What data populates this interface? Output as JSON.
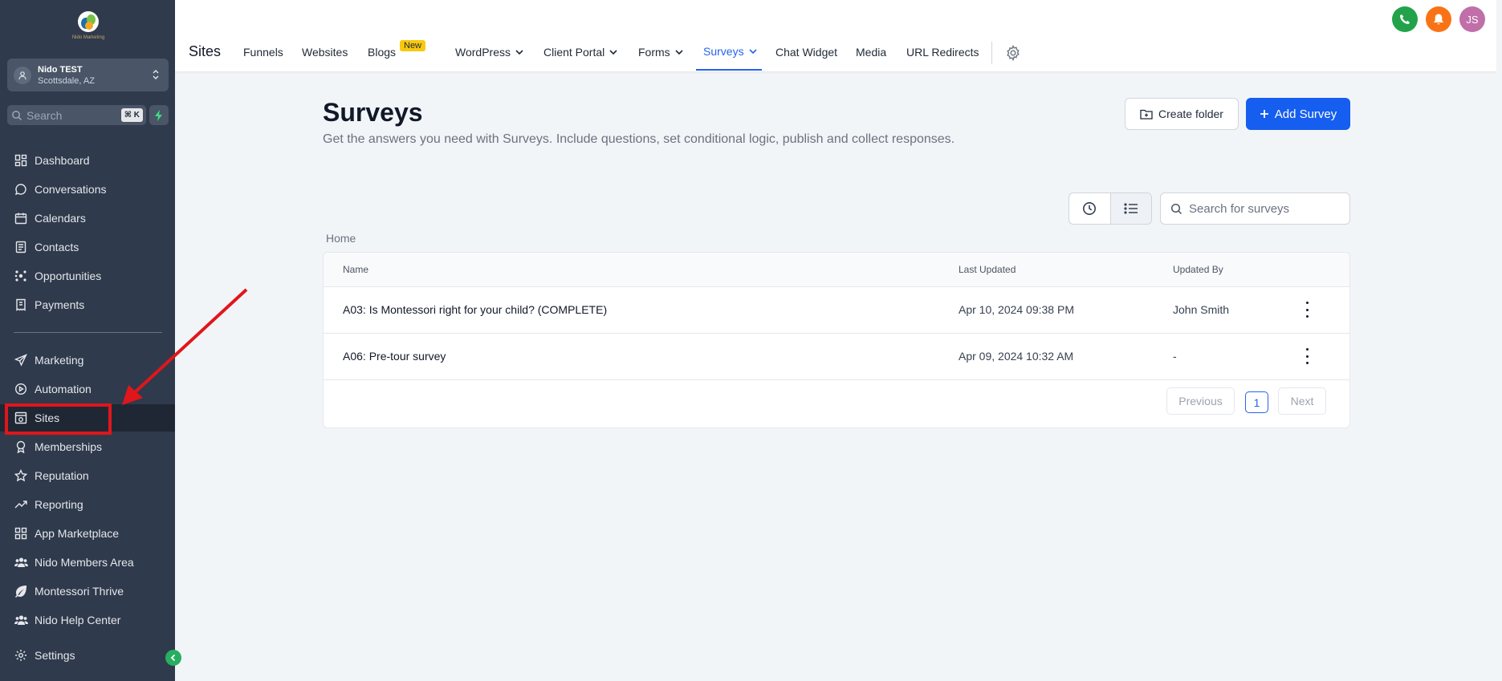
{
  "brand": {
    "logo_text": "Nido Marketing"
  },
  "account": {
    "name": "Nido TEST",
    "location": "Scottsdale, AZ"
  },
  "sidebar": {
    "search_placeholder": "Search",
    "search_shortcut": "⌘ K",
    "items": [
      {
        "label": "Dashboard",
        "icon": "dashboard-icon"
      },
      {
        "label": "Conversations",
        "icon": "chat-icon"
      },
      {
        "label": "Calendars",
        "icon": "calendar-icon"
      },
      {
        "label": "Contacts",
        "icon": "contacts-icon"
      },
      {
        "label": "Opportunities",
        "icon": "opportunities-icon"
      },
      {
        "label": "Payments",
        "icon": "payments-icon"
      },
      {
        "label": "Marketing",
        "icon": "send-icon"
      },
      {
        "label": "Automation",
        "icon": "automation-icon"
      },
      {
        "label": "Sites",
        "icon": "sites-icon",
        "active": true
      },
      {
        "label": "Memberships",
        "icon": "award-icon"
      },
      {
        "label": "Reputation",
        "icon": "star-icon"
      },
      {
        "label": "Reporting",
        "icon": "trend-icon"
      },
      {
        "label": "App Marketplace",
        "icon": "grid-icon"
      },
      {
        "label": "Nido Members Area",
        "icon": "users-icon"
      },
      {
        "label": "Montessori Thrive",
        "icon": "leaf-icon"
      },
      {
        "label": "Nido Help Center",
        "icon": "users-icon"
      },
      {
        "label": "Settings",
        "icon": "gear-icon"
      }
    ]
  },
  "topbar": {
    "title": "Sites",
    "tabs": [
      {
        "label": "Funnels"
      },
      {
        "label": "Websites"
      },
      {
        "label": "Blogs",
        "badge": "New"
      },
      {
        "label": "WordPress",
        "dropdown": true
      },
      {
        "label": "Client Portal",
        "dropdown": true
      },
      {
        "label": "Forms",
        "dropdown": true
      },
      {
        "label": "Surveys",
        "dropdown": true,
        "active": true
      },
      {
        "label": "Chat Widget"
      },
      {
        "label": "Media"
      },
      {
        "label": "URL Redirects"
      }
    ],
    "user_initials": "JS"
  },
  "page": {
    "title": "Surveys",
    "description": "Get the answers you need with Surveys. Include questions, set conditional logic, publish and collect responses.",
    "create_folder_label": "Create folder",
    "add_survey_label": "Add Survey",
    "search_placeholder": "Search for surveys",
    "breadcrumb": "Home"
  },
  "table": {
    "columns": [
      "Name",
      "Last Updated",
      "Updated By"
    ],
    "rows": [
      {
        "name": "A03: Is Montessori right for your child? (COMPLETE)",
        "last_updated": "Apr 10, 2024 09:38 PM",
        "updated_by": "John Smith"
      },
      {
        "name": "A06: Pre-tour survey",
        "last_updated": "Apr 09, 2024 10:32 AM",
        "updated_by": "-"
      }
    ],
    "pagination": {
      "previous": "Previous",
      "current": "1",
      "next": "Next"
    }
  },
  "colors": {
    "sidebar_bg": "#2f3a4c",
    "accent": "#155eef",
    "highlight": "#e0161b",
    "new_badge": "#f9c80e"
  }
}
